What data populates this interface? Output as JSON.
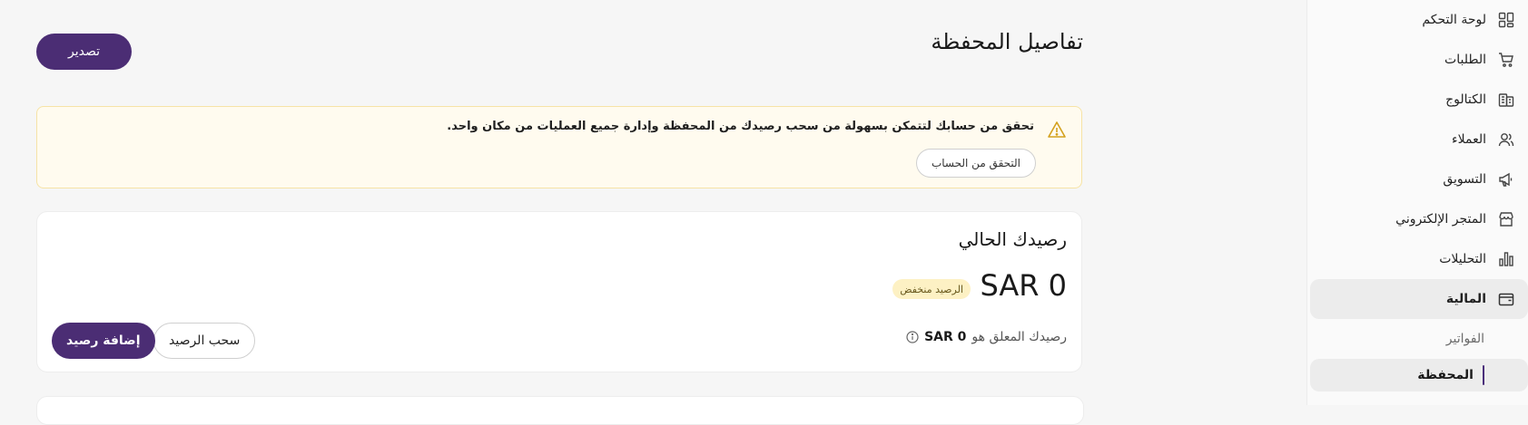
{
  "sidebar": {
    "items": [
      {
        "label": "لوحة التحكم",
        "icon": "dashboard-icon"
      },
      {
        "label": "الطلبات",
        "icon": "cart-icon"
      },
      {
        "label": "الكتالوج",
        "icon": "catalog-icon"
      },
      {
        "label": "العملاء",
        "icon": "users-icon"
      },
      {
        "label": "التسويق",
        "icon": "megaphone-icon"
      },
      {
        "label": "المتجر الإلكتروني",
        "icon": "store-icon"
      },
      {
        "label": "التحليلات",
        "icon": "bar-chart-icon"
      },
      {
        "label": "المالية",
        "icon": "wallet-icon"
      }
    ],
    "sub_items": [
      {
        "label": "الفواتير"
      },
      {
        "label": "المحفظة"
      }
    ]
  },
  "header": {
    "title": "تفاصيل المحفظة",
    "export_label": "تصدير"
  },
  "alert": {
    "message": "تحقق من حسابك لتتمكن بسهولة من سحب رصيدك من المحفظة وإدارة جميع العمليات من مكان واحد.",
    "verify_label": "التحقق من الحساب"
  },
  "balance": {
    "title": "رصيدك الحالي",
    "amount": "SAR 0",
    "badge": "الرصيد منخفض",
    "pending_label": "رصيدك المعلق هو",
    "pending_amount": "SAR 0",
    "withdraw_label": "سحب الرصيد",
    "add_label": "إضافة رصيد"
  },
  "colors": {
    "primary": "#4b2d74",
    "alert_bg": "#fffbef",
    "badge_bg": "#fdf1c4"
  }
}
